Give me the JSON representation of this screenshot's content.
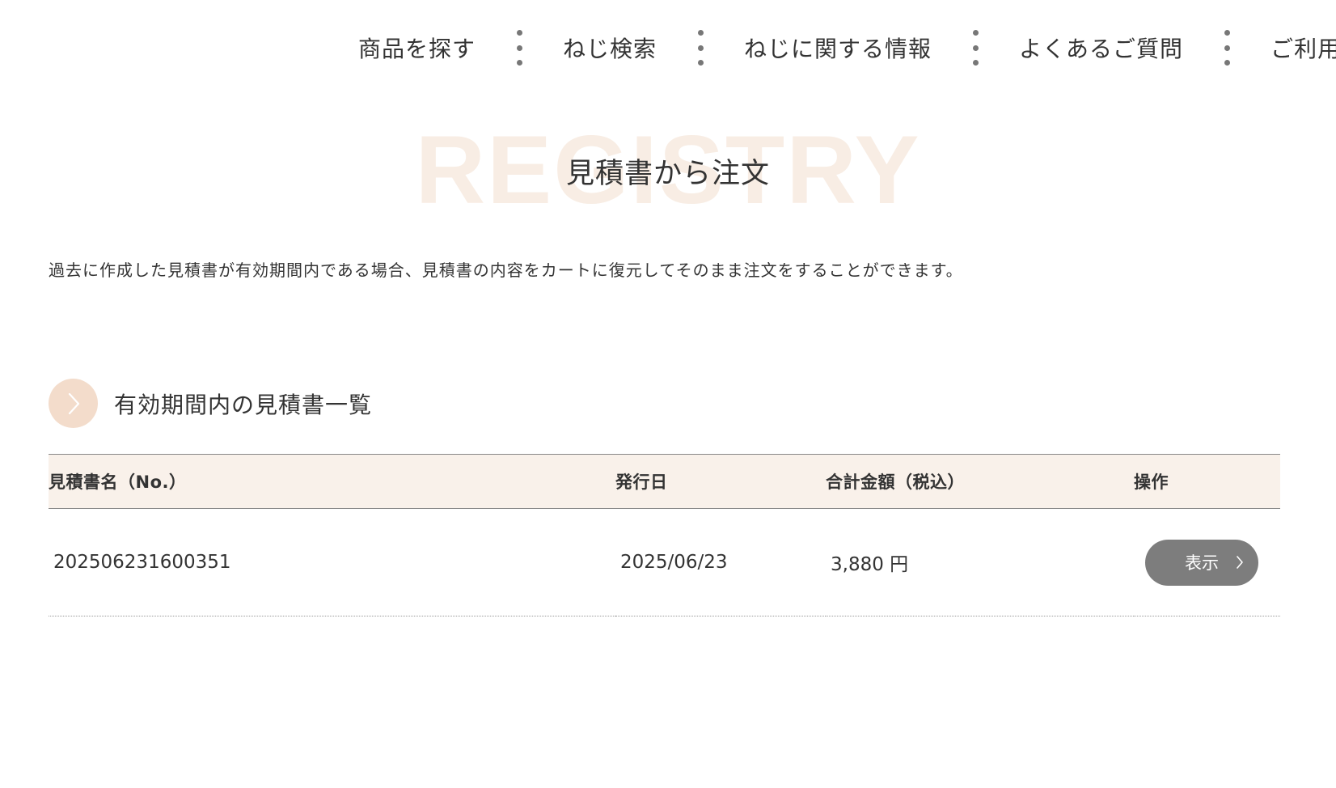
{
  "nav": {
    "items": [
      {
        "label": "商品を探す"
      },
      {
        "label": "ねじ検索"
      },
      {
        "label": "ねじに関する情報"
      },
      {
        "label": "よくあるご質問"
      },
      {
        "label": "ご利用"
      }
    ]
  },
  "hero": {
    "bg_text": "REGISTRY",
    "title": "見積書から注文"
  },
  "description": "過去に作成した見積書が有効期間内である場合、見積書の内容をカートに復元してそのまま注文をすることができます。",
  "section": {
    "title": "有効期間内の見積書一覧",
    "icon": "chevron-right-icon"
  },
  "table": {
    "headers": {
      "name": "見積書名（No.）",
      "date": "発行日",
      "total": "合計金額（税込）",
      "action": "操作"
    },
    "rows": [
      {
        "name": "202506231600351",
        "date": "2025/06/23",
        "total": "3,880 円",
        "action_label": "表示"
      }
    ]
  },
  "colors": {
    "accent_circle": "#f3dccb",
    "table_header_bg": "#f9f1ea",
    "button_bg": "#7d7d7d",
    "hero_bg_text": "#f8ede4"
  }
}
